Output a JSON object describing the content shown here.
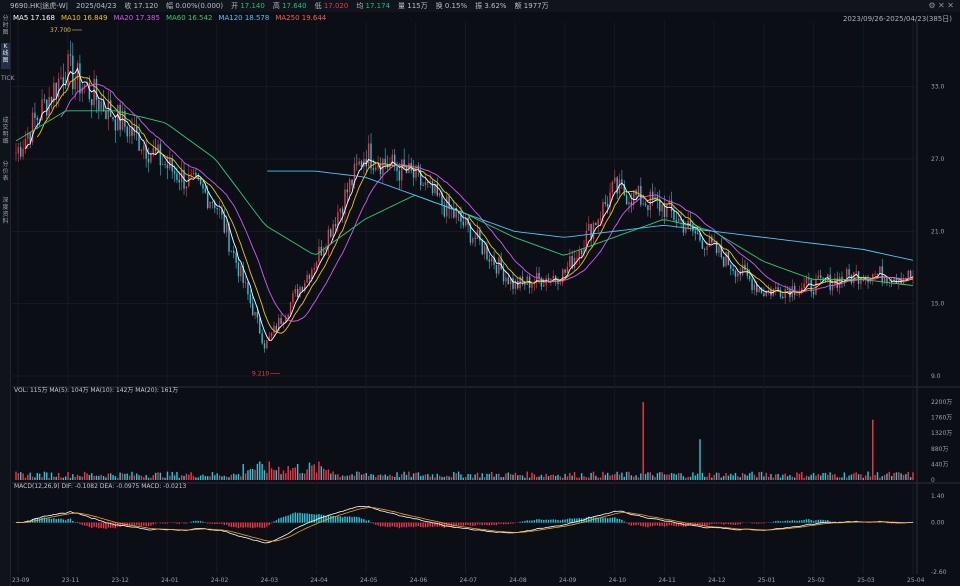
{
  "header": {
    "symbol": "9690.HK|途虎-W|",
    "date": "2025/04/23",
    "close_label": "收 17.120",
    "change_label": "幅 0.00%(0.000)",
    "open_label": "开",
    "open": "17.140",
    "high_label": "高",
    "high": "17.640",
    "low_label": "低",
    "low": "17.020",
    "avg_label": "均",
    "avg": "17.174",
    "volume_label": "量 115万",
    "turnover_label": "换 0.15%",
    "amplitude_label": "振 3.62%",
    "amount_label": "额 1977万"
  },
  "window_controls": "⚙ ✕ ✕",
  "sidebar": {
    "tabs": [
      {
        "label": "分时图"
      },
      {
        "label": "K线图",
        "active": true
      },
      {
        "label": "TICK"
      },
      {
        "label": "成交明细"
      },
      {
        "label": "分价表"
      },
      {
        "label": "深度资料"
      }
    ]
  },
  "ma_legend": [
    {
      "label": "MA5",
      "value": "17.168",
      "color": "#ffffff"
    },
    {
      "label": "MA10",
      "value": "16.849",
      "color": "#f0c419"
    },
    {
      "label": "MA20",
      "value": "17.385",
      "color": "#d35cf0"
    },
    {
      "label": "MA60",
      "value": "16.542",
      "color": "#2ecc71"
    },
    {
      "label": "MA120",
      "value": "18.578",
      "color": "#4fc3f7"
    },
    {
      "label": "MA250",
      "value": "19.644",
      "color": "#ff5b5b"
    }
  ],
  "range_text": "2023/09/26-2025/04/23(385日)",
  "price_axis": [
    "33.0",
    "27.0",
    "21.0",
    "15.0",
    "9.0"
  ],
  "annotations": {
    "high": "37.700",
    "low": "9.210"
  },
  "volume_legend": {
    "vol": "VOL: 115万",
    "ma5": "MA(5): 104万",
    "ma10": "MA(10): 142万",
    "ma20": "MA(20): 161万"
  },
  "volume_axis": [
    "2200万",
    "1760万",
    "1320万",
    "880万",
    "440万",
    "0"
  ],
  "macd_legend": {
    "name": "MACD(12,26,9)",
    "dif": "DIF: -0.1082",
    "dea": "DEA: -0.0975",
    "macd": "MACD: -0.0213"
  },
  "macd_axis": [
    "1.40",
    "0.00",
    "-2.60"
  ],
  "date_axis": [
    "23-09",
    "23-11",
    "23-12",
    "24-01",
    "24-02",
    "24-03",
    "24-04",
    "24-05",
    "24-06",
    "24-07",
    "24-08",
    "24-09",
    "24-10",
    "24-11",
    "24-12",
    "25-01",
    "25-02",
    "25-03",
    "25-04"
  ],
  "colors": {
    "up": "#f23645",
    "down": "#26c6da",
    "bg": "#0b0e14",
    "grid": "#1b2029"
  },
  "chart_data": {
    "type": "line",
    "title": "",
    "x": [
      "23-09",
      "23-11",
      "23-12",
      "24-01",
      "24-02",
      "24-03",
      "24-04",
      "24-05",
      "24-06",
      "24-07",
      "24-08",
      "24-09",
      "24-10",
      "24-11",
      "24-12",
      "25-01",
      "25-02",
      "25-03",
      "25-04"
    ],
    "ylim": [
      9,
      37.7
    ],
    "series": [
      {
        "name": "MA5",
        "values": [
          27.5,
          34.5,
          30.5,
          26.5,
          23.5,
          11.5,
          18.5,
          27.5,
          25.5,
          21.5,
          16.5,
          17.5,
          24.5,
          23.0,
          19.5,
          16.0,
          16.5,
          17.5,
          17.2
        ]
      },
      {
        "name": "MA60",
        "values": [
          28.5,
          31.0,
          31.0,
          30.0,
          27.0,
          21.5,
          19.0,
          22.0,
          24.0,
          22.5,
          20.5,
          19.0,
          20.5,
          22.0,
          21.0,
          18.5,
          17.0,
          17.0,
          16.5
        ]
      },
      {
        "name": "MA120",
        "values": [
          null,
          null,
          null,
          null,
          null,
          null,
          26.0,
          25.5,
          24.0,
          22.5,
          21.0,
          20.5,
          21.0,
          21.5,
          21.0,
          20.5,
          20.0,
          19.5,
          18.6
        ]
      }
    ],
    "volume_ylim": [
      0,
      2200
    ],
    "macd_ylim": [
      -2.6,
      1.4
    ]
  }
}
